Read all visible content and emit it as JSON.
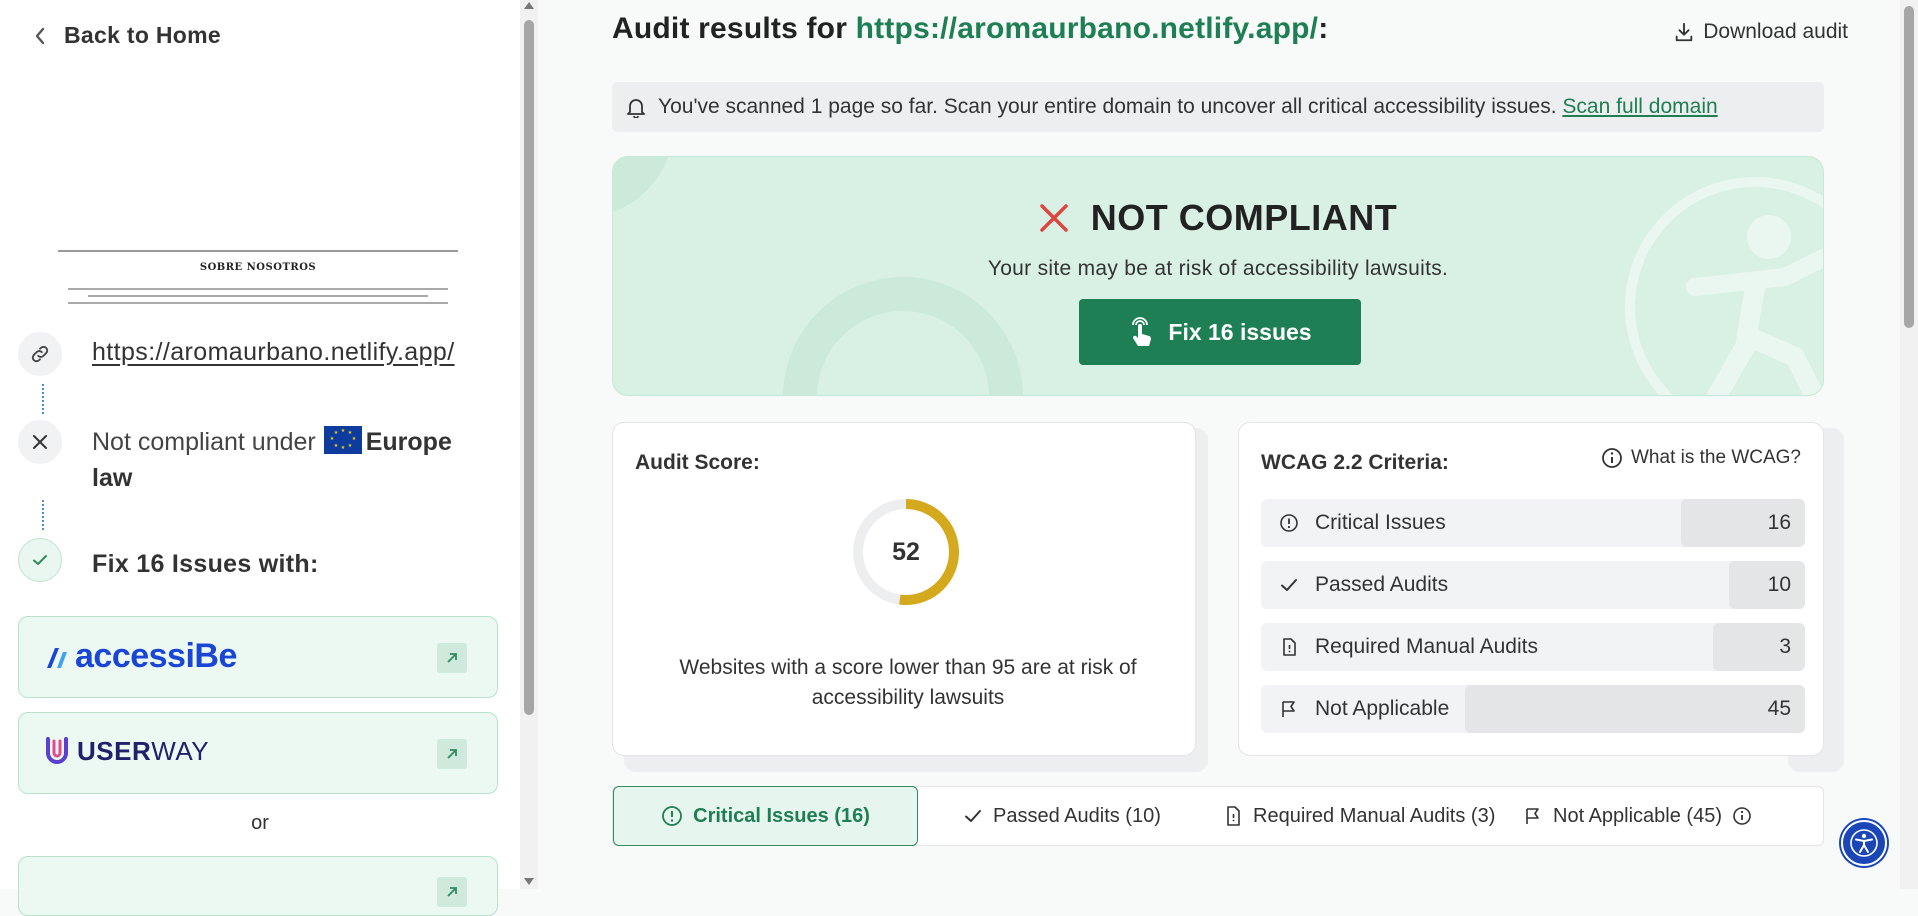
{
  "sidebar": {
    "back_label": "Back to Home",
    "preview_title": "SOBRE NOSOTROS",
    "site_url": "https://aromaurbano.netlify.app/",
    "law_text": "Not compliant under",
    "law_region": "Europe",
    "law_suffix": "law",
    "fix_with": "Fix 16 Issues with:",
    "vendors": [
      {
        "name": "accessiBe",
        "color": "#1a46d6"
      },
      {
        "name_a": "USER",
        "name_b": "WAY",
        "color": "#22206a"
      }
    ],
    "or_label": "or"
  },
  "main": {
    "heading_prefix": "Audit results for",
    "heading_url": "https://aromaurbano.netlify.app/",
    "heading_suffix": ":",
    "download_label": "Download audit",
    "banner": {
      "text": "You've scanned 1 page so far. Scan your entire domain to uncover all critical accessibility issues.",
      "link": "Scan full domain"
    },
    "status": {
      "title": "NOT COMPLIANT",
      "subtitle": "Your site may be at risk of accessibility lawsuits.",
      "button": "Fix 16 issues"
    },
    "score": {
      "title": "Audit Score:",
      "value": "52",
      "fraction": 0.52,
      "note": "Websites with a score lower than 95 are at risk of accessibility lawsuits"
    },
    "wcag": {
      "title": "WCAG 2.2 Criteria:",
      "help": "What is the WCAG?",
      "rows": [
        {
          "label": "Critical Issues",
          "count": "16",
          "icon": "alert-circle-icon"
        },
        {
          "label": "Passed Audits",
          "count": "10",
          "icon": "check-icon"
        },
        {
          "label": "Required Manual Audits",
          "count": "3",
          "icon": "document-icon"
        },
        {
          "label": "Not Applicable",
          "count": "45",
          "icon": "flag-icon"
        }
      ]
    },
    "tabs": [
      {
        "label": "Critical Issues (16)"
      },
      {
        "label": "Passed Audits (10)"
      },
      {
        "label": "Required Manual Audits (3)"
      },
      {
        "label": "Not Applicable (45)"
      }
    ]
  },
  "colors": {
    "brand_green": "#1f7f54",
    "hero_bg": "#d8f1e4",
    "gauge": "#d4a91e",
    "error_red": "#e0443e",
    "eu_blue": "#0e3c9e"
  }
}
